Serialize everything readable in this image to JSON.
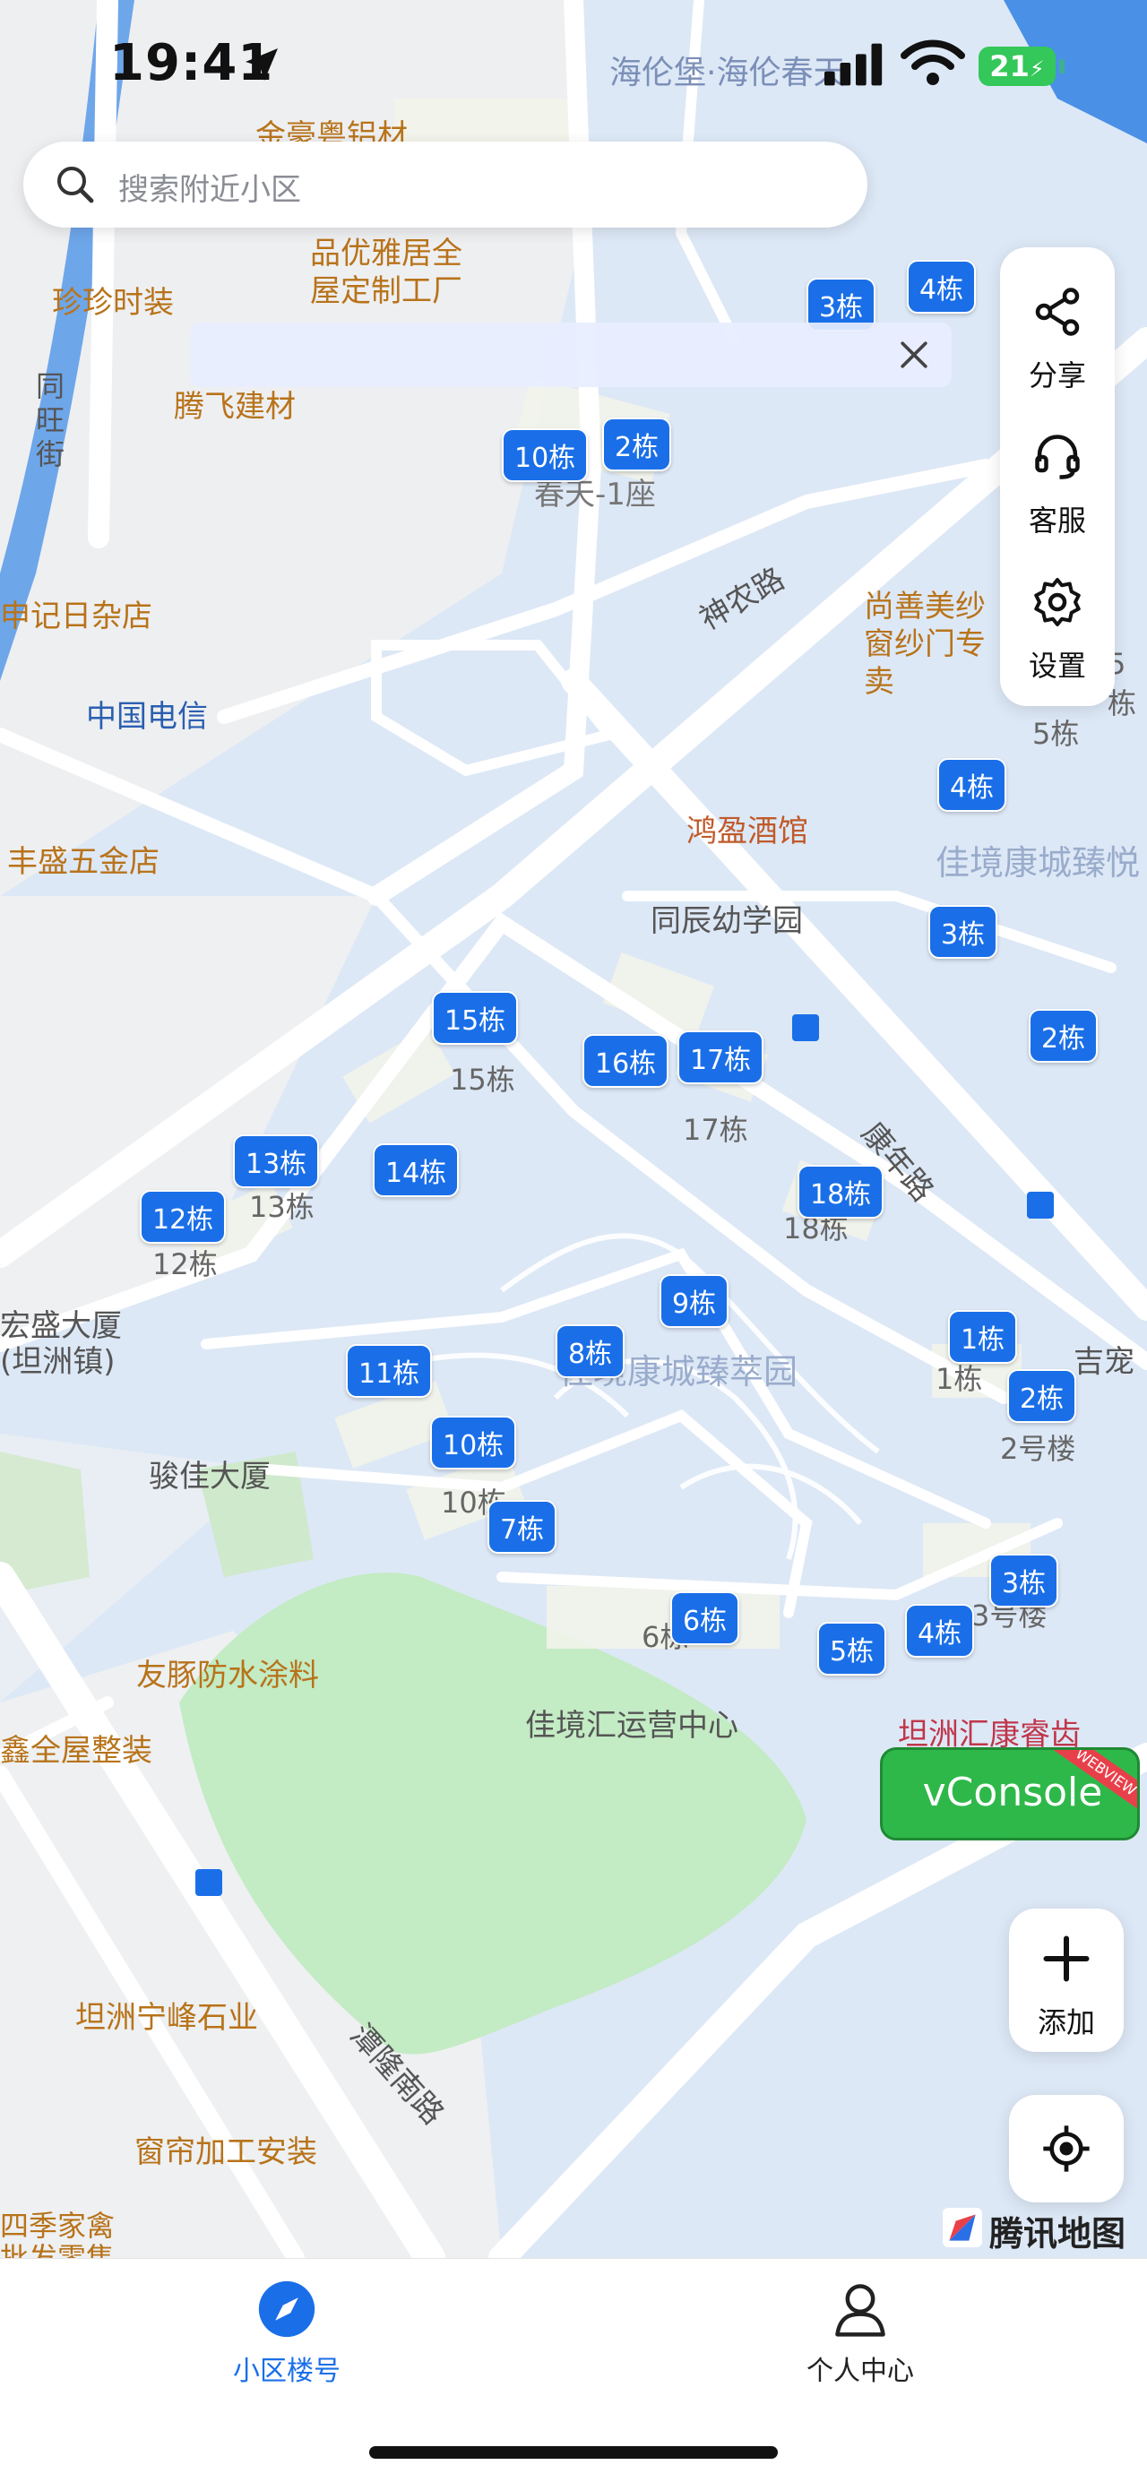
{
  "status_bar": {
    "time": "19:41",
    "battery": "21"
  },
  "search": {
    "placeholder": "搜索附近小区"
  },
  "side_actions": [
    {
      "label": "分享",
      "icon": "share-icon"
    },
    {
      "label": "客服",
      "icon": "headset-icon"
    },
    {
      "label": "设置",
      "icon": "gear-icon"
    }
  ],
  "add_button": {
    "label": "添加",
    "icon": "plus-icon"
  },
  "vconsole": {
    "label": "vConsole",
    "ribbon": "WEBVIEW"
  },
  "map_brand": "腾讯地图",
  "tabbar": [
    {
      "label": "小区楼号",
      "active": true,
      "icon": "compass-icon"
    },
    {
      "label": "个人中心",
      "active": false,
      "icon": "user-icon"
    }
  ],
  "colors": {
    "marker": "#1a6fe8",
    "tab_active": "#1a6fe8",
    "vconsole": "#2fb84a",
    "poi": "#e0a020"
  },
  "map": {
    "markers": [
      "4栋",
      "3栋",
      "2栋",
      "10栋",
      "15栋",
      "16栋",
      "17栋",
      "13栋",
      "14栋",
      "12栋",
      "18栋",
      "9栋",
      "8栋",
      "11栋",
      "10栋",
      "7栋",
      "6栋",
      "5栋",
      "4栋",
      "3栋",
      "1栋",
      "2栋",
      "4栋",
      "3栋",
      "2栋"
    ],
    "building_labels": [
      "15栋",
      "17栋",
      "13栋",
      "12栋",
      "18栋",
      "10栋",
      "6栋",
      "3号楼",
      "2号楼",
      "1栋",
      "5栋",
      "5栋"
    ],
    "poi_labels": [
      "金豪粤铝材",
      "品优雅居全屋定制工厂",
      "珍珍时装",
      "腾飞建材",
      "中国电信",
      "丰盛五金店",
      "鸿盈酒馆",
      "同辰幼学园",
      "骏佳大厦",
      "友豚防水涂料",
      "鑫全屋整装",
      "坦洲宁峰石业",
      "窗帘加工安装",
      "四季家禽批发零售",
      "佳境汇运营中心",
      "坦洲汇康睿齿",
      "吉宠"
    ],
    "area_labels": [
      "海伦堡·海伦春天",
      "佳境康城臻萃园",
      "佳境康城臻悦",
      "尚善美纱窗纱门专卖",
      "宏盛大厦(坦洲镇)",
      "申记日杂店",
      "春天-1座"
    ],
    "road_labels": [
      "神农路",
      "康年路",
      "潭隆南路",
      "同旺街"
    ]
  }
}
